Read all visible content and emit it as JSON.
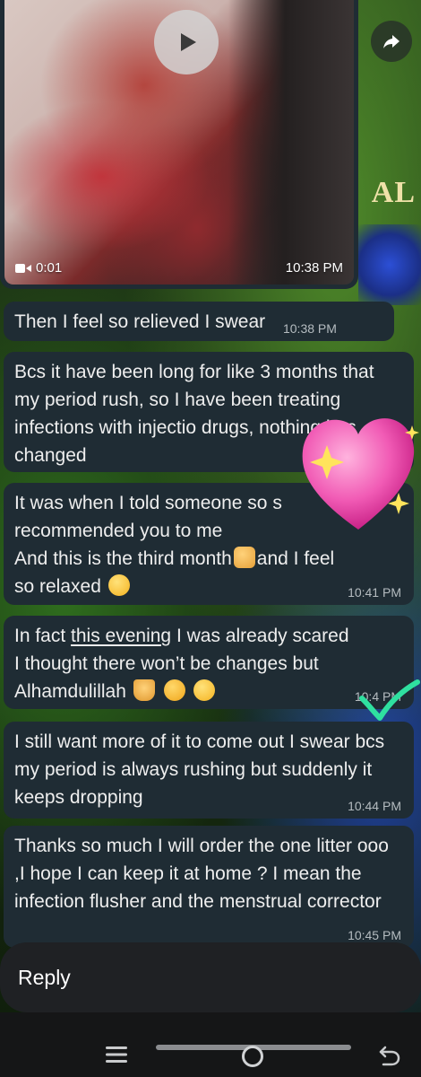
{
  "video": {
    "duration": "0:01",
    "time": "10:38 PM"
  },
  "wallpaper_text": "AL",
  "messages": [
    {
      "text": "Then I feel so relieved I swear",
      "time": "10:38 PM"
    },
    {
      "text": "Bcs it have been long for like 3 months that my period rush, so I have been treating infections with injectio drugs, nothing has changed",
      "time": ""
    },
    {
      "line1": "It was when I told someone so s",
      "line2": "recommended you to me",
      "line3a": "And this is the third month",
      "line3b": "and I feel",
      "line4": "so relaxed",
      "time": "10:41 PM"
    },
    {
      "line1a": "In fact ",
      "line1b": "this evening",
      "line1c": " I was already scared",
      "line2": "I thought there won’t be changes but",
      "line3": "Alhamdulillah",
      "time": "10:4 PM"
    },
    {
      "text": "I still want more of it to come out I swear bcs my period is always rushing but suddenly it keeps dropping",
      "time": "10:44 PM"
    },
    {
      "text": "Thanks so much I will order the one litter ooo ,I hope I can keep it at home ? I mean the infection flusher and the menstrual corrector",
      "time": "10:45 PM"
    }
  ],
  "reply": {
    "label": "Reply"
  },
  "icons": {
    "play": "play-icon",
    "video": "video-camera-icon",
    "forward": "forward-arrow-icon",
    "heart": "sparkling-heart-sticker",
    "check": "green-check-sticker",
    "nav_menu": "recent-apps-icon",
    "nav_home": "home-pill-icon",
    "nav_back": "back-icon"
  },
  "colors": {
    "bubble": "#1f2c34",
    "timestamp": "#b5bcc0",
    "heart": "#f15bb5",
    "check": "#2fe0a0"
  }
}
